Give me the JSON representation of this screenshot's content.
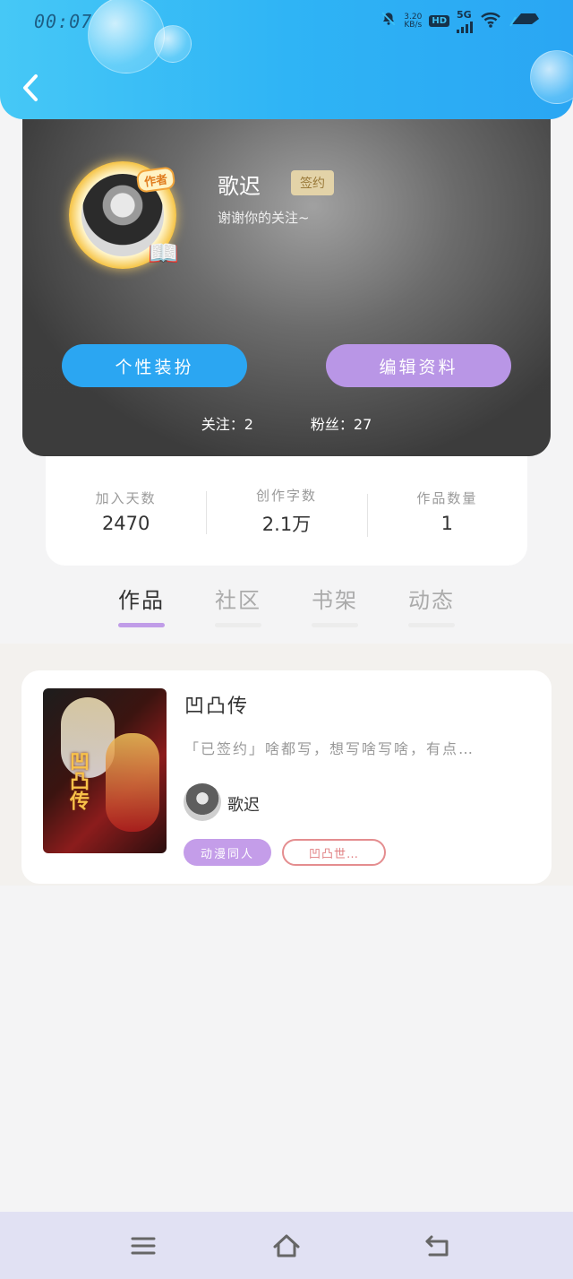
{
  "status_bar": {
    "time": "00:07",
    "speed_value": "3.20",
    "speed_unit": "KB/s",
    "hd_label": "HD",
    "network_label": "5G",
    "icons": [
      "bell-off-icon",
      "wifi-icon",
      "battery-icon"
    ]
  },
  "header": {
    "back_icon": "chevron-left-icon"
  },
  "profile": {
    "avatar_badge": "作者",
    "username": "歌迟",
    "sign_badge": "签约",
    "bio": "谢谢你的关注~",
    "dress_button": "个性装扮",
    "edit_button": "编辑资料",
    "following": "关注：2",
    "followers": "粉丝：27"
  },
  "stats": [
    {
      "label": "加入天数",
      "value": "2470"
    },
    {
      "label": "创作字数",
      "value": "2.1万"
    },
    {
      "label": "作品数量",
      "value": "1"
    }
  ],
  "tabs": [
    {
      "label": "作品",
      "active": true
    },
    {
      "label": "社区",
      "active": false
    },
    {
      "label": "书架",
      "active": false
    },
    {
      "label": "动态",
      "active": false
    }
  ],
  "book": {
    "cover_text": "凹凸传",
    "title": "凹凸传",
    "description": "「已签约」啥都写，想写啥写啥，有点…",
    "author": "歌迟",
    "tags": [
      "动漫同人",
      "凹凸世…"
    ]
  },
  "nav": {
    "icons": [
      "menu-icon",
      "home-icon",
      "back-arrow-icon"
    ]
  }
}
